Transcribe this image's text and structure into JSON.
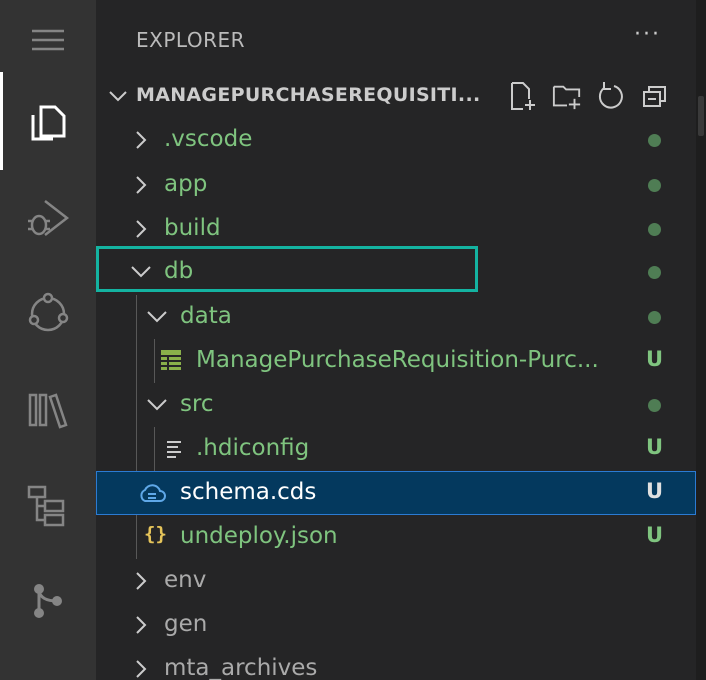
{
  "explorer": {
    "title": "EXPLORER",
    "more_label": "···",
    "section_title": "MANAGEPURCHASEREQUISITI...",
    "header_actions": [
      "new-file-icon",
      "new-folder-icon",
      "refresh-icon",
      "collapse-all-icon"
    ]
  },
  "activity_bar": {
    "items": [
      "menu-icon",
      "explorer-icon",
      "run-debug-icon",
      "source-control-icon",
      "extensions-icon",
      "sap-tree-icon",
      "git-graph-icon"
    ]
  },
  "tree": {
    "items": [
      {
        "label": ".vscode",
        "status": ""
      },
      {
        "label": "app",
        "status": ""
      },
      {
        "label": "build",
        "status": ""
      },
      {
        "label": "db",
        "status": ""
      },
      {
        "label": "data",
        "status": ""
      },
      {
        "label": "ManagePurchaseRequisition-Purc...",
        "status": "U"
      },
      {
        "label": "src",
        "status": ""
      },
      {
        "label": ".hdiconfig",
        "status": "U"
      },
      {
        "label": "schema.cds",
        "status": "U"
      },
      {
        "label": "undeploy.json",
        "status": "U"
      },
      {
        "label": "env",
        "status": ""
      },
      {
        "label": "gen",
        "status": ""
      },
      {
        "label": "mta_archives",
        "status": ""
      }
    ]
  },
  "colors": {
    "accent_highlight": "#14b3a1",
    "selection": "#04395e",
    "untracked_green": "#7fc47f"
  }
}
